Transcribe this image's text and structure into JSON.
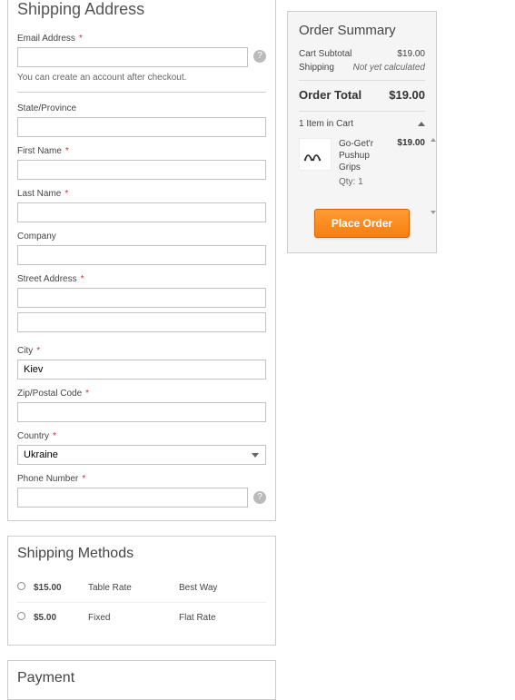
{
  "shipping": {
    "title": "Shipping Address",
    "email_label": "Email Address",
    "email_note": "You can create an account after checkout.",
    "state_label": "State/Province",
    "first_name_label": "First Name",
    "last_name_label": "Last Name",
    "company_label": "Company",
    "street_label": "Street Address",
    "city_label": "City",
    "city_value": "Kiev",
    "zip_label": "Zip/Postal Code",
    "country_label": "Country",
    "country_value": "Ukraine",
    "phone_label": "Phone Number"
  },
  "methods": {
    "title": "Shipping Methods",
    "rows": [
      {
        "price": "$15.00",
        "method": "Table Rate",
        "carrier": "Best Way"
      },
      {
        "price": "$5.00",
        "method": "Fixed",
        "carrier": "Flat Rate"
      }
    ]
  },
  "payment": {
    "title": "Payment"
  },
  "summary": {
    "title": "Order Summary",
    "subtotal_label": "Cart Subtotal",
    "subtotal_value": "$19.00",
    "shipping_label": "Shipping",
    "shipping_value": "Not yet calculated",
    "total_label": "Order Total",
    "total_value": "$19.00",
    "items_label": "1 Item in Cart",
    "item": {
      "name": "Go-Get'r Pushup Grips",
      "qty_label": "Qty: 1",
      "price": "$19.00"
    },
    "place_order_label": "Place Order"
  }
}
